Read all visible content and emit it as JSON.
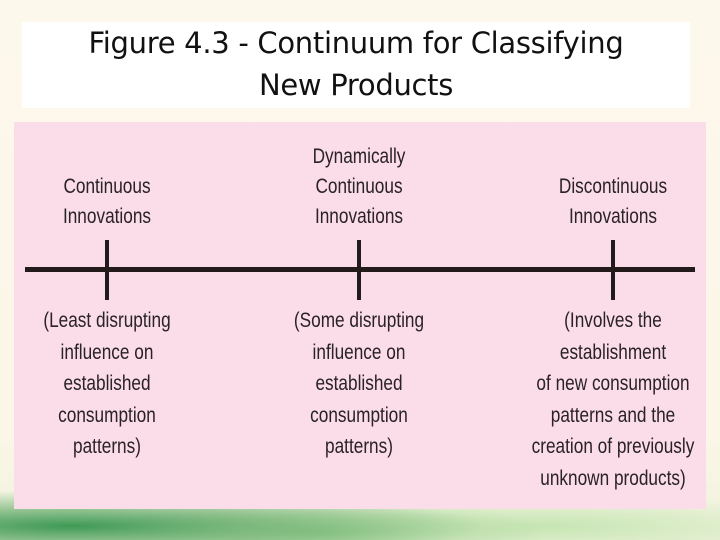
{
  "title": {
    "line1": "Figure 4.3 - Continuum for Classifying",
    "line2": "New Products"
  },
  "diagram": {
    "type": "continuum",
    "points": [
      {
        "name_lines": [
          "Continuous",
          "Innovations"
        ],
        "description_lines": [
          "(Least disrupting",
          "influence on",
          "established",
          "consumption",
          "patterns)"
        ]
      },
      {
        "name_lines": [
          "Dynamically",
          "Continuous",
          "Innovations"
        ],
        "description_lines": [
          "(Some disrupting",
          "influence on",
          "established",
          "consumption",
          "patterns)"
        ]
      },
      {
        "name_lines": [
          "Discontinuous",
          "Innovations"
        ],
        "description_lines": [
          "(Involves the",
          "establishment",
          "of new consumption",
          "patterns and the",
          "creation of previously",
          "unknown products)"
        ]
      }
    ]
  },
  "colors": {
    "panel_background": "#fadde9",
    "axis_line": "#231a1c",
    "text": "#2a2224",
    "title_background": "#ffffff"
  }
}
